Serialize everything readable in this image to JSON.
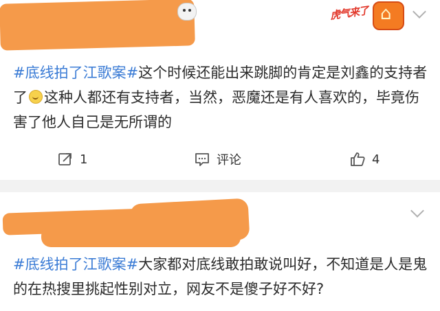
{
  "posts": [
    {
      "hashtag": "#底线拍了江歌案#",
      "text_before_emoji": "这个时候还能出来跳脚的肯定是刘鑫的支持者了",
      "emoji": "smile-emoji",
      "text_after_emoji": "这种人都还有支持者，当然，恶魔还是有人喜欢的，毕竟伤害了他人自己是无所谓的",
      "badge_text": "虎气来了",
      "actions": {
        "forward_count": "1",
        "comment_label": "评论",
        "like_count": "4"
      }
    },
    {
      "hashtag": "#底线拍了江歌案#",
      "text": "大家都对底线敢拍敢说叫好，不知道是人是鬼的在热搜里挑起性别对立，网友不是傻子好不好?"
    }
  ],
  "colors": {
    "hashtag": "#3a7bd5",
    "redaction": "#f59a4a",
    "page_background": "#f2f2f2",
    "card_background": "#ffffff"
  }
}
